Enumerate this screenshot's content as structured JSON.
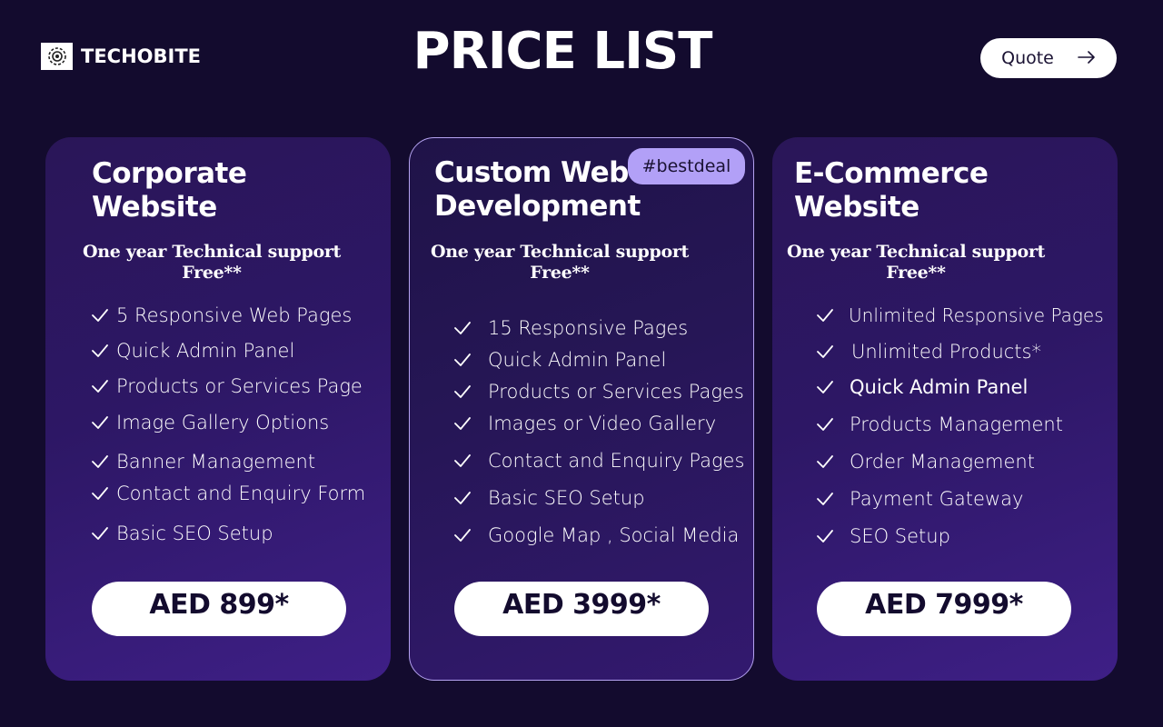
{
  "brand": {
    "name": "TECHOBITE",
    "logo_icon": "gear-cog-icon"
  },
  "page_title": "PRICE LIST",
  "quote_button": {
    "label": "Quote",
    "icon": "arrow-right-icon"
  },
  "colors": {
    "background": "#130b2e",
    "card_gradient_start": "#2a1658",
    "card_gradient_end": "#3e1f86",
    "badge": "#b2a0f7",
    "featured_border": "#b4a2f0"
  },
  "plans": [
    {
      "title_line1": "Corporate",
      "title_line2": "Website",
      "support_line1": "One year Technical support",
      "support_line2": "Free**",
      "features": [
        "5 Responsive Web Pages",
        "Quick Admin Panel",
        "Products or Services Page",
        "Image Gallery Options",
        "Banner Management",
        "Contact and Enquiry Form",
        "Basic SEO Setup"
      ],
      "price": "AED 899*"
    },
    {
      "title_line1": "Custom Web",
      "title_line2": "Development",
      "badge": "#bestdeal",
      "support_line1": "One year Technical support",
      "support_line2": "Free**",
      "features": [
        "15 Responsive Pages",
        "Quick Admin Panel",
        "Products or Services Pages",
        "Images or Video Gallery",
        "Contact and Enquiry Pages",
        "Basic SEO Setup",
        "Google Map , Social Media"
      ],
      "price": "AED 3999*"
    },
    {
      "title_line1": "E-Commerce",
      "title_line2": "Website",
      "support_line1": "One year Technical support",
      "support_line2": "Free**",
      "features": [
        "Unlimited Responsive Pages",
        "Unlimited Products*",
        "Quick Admin Panel",
        "Products Management",
        "Order Management",
        "Payment Gateway",
        "SEO Setup"
      ],
      "price": "AED 7999*"
    }
  ]
}
